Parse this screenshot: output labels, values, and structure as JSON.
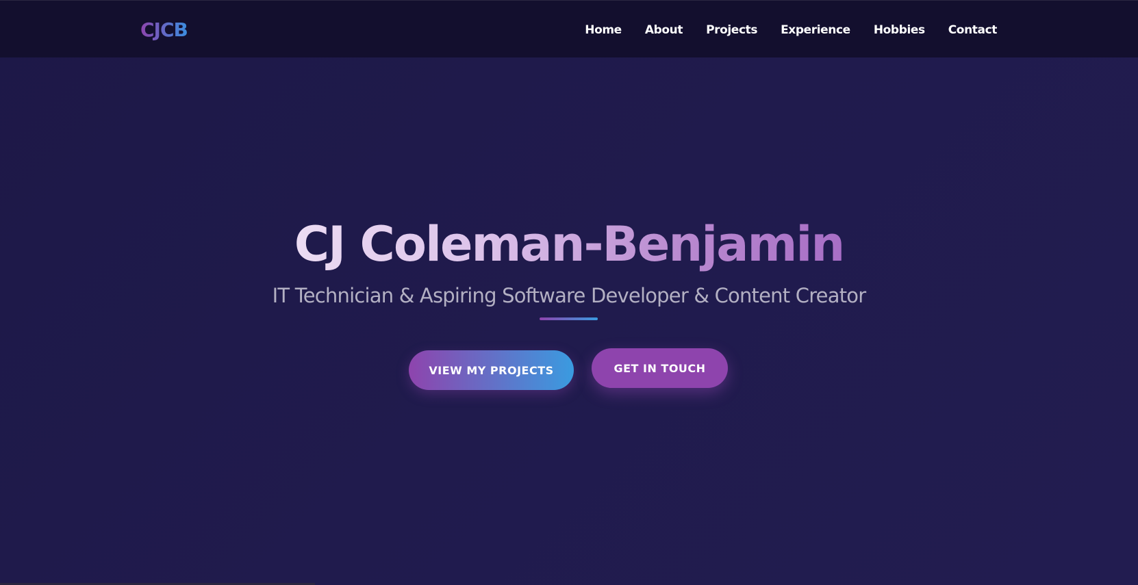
{
  "nav": {
    "logo": "CJCB",
    "links": [
      "Home",
      "About",
      "Projects",
      "Experience",
      "Hobbies",
      "Contact"
    ]
  },
  "hero": {
    "title": "CJ Coleman-Benjamin",
    "subtitle": "IT Technician & Aspiring Software Developer & Content Creator",
    "primary_button": "VIEW MY PROJECTS",
    "secondary_button": "GET IN TOUCH"
  },
  "colors": {
    "background": "#1e1a4a",
    "navbar": "#130f2e",
    "accent_purple": "#8e44ad",
    "accent_blue": "#3a9be0",
    "subtitle_text": "#b3b0c3"
  }
}
